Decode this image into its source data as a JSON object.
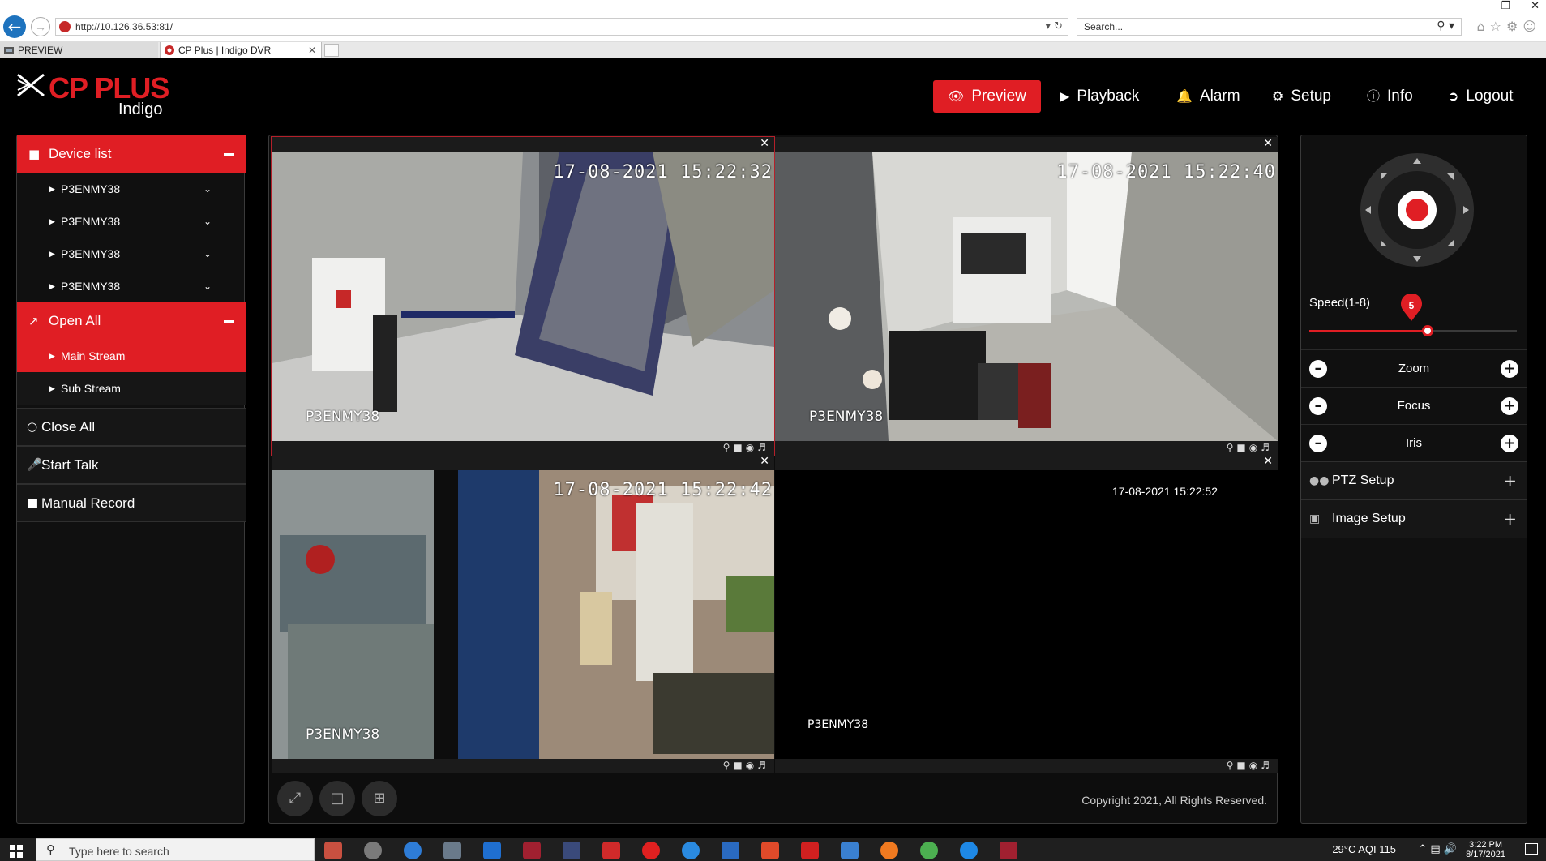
{
  "browser": {
    "url": "http://10.126.36.53:81/",
    "search_placeholder": "Search...",
    "tabs": [
      {
        "label": "PREVIEW"
      },
      {
        "label": "CP Plus | Indigo DVR"
      }
    ]
  },
  "app": {
    "brand": "CP PLUS",
    "subbrand": "Indigo",
    "accent_color": "#e01e24",
    "nav": [
      {
        "label": "Preview",
        "icon": "eye-icon",
        "active": true
      },
      {
        "label": "Playback",
        "icon": "play-circle-icon"
      },
      {
        "label": "Alarm",
        "icon": "bell-icon"
      },
      {
        "label": "Setup",
        "icon": "gear-icon"
      },
      {
        "label": "Info",
        "icon": "info-icon"
      },
      {
        "label": "Logout",
        "icon": "logout-icon"
      }
    ]
  },
  "sidebar": {
    "device_list_label": "Device list",
    "devices": [
      {
        "label": "P3ENMY38"
      },
      {
        "label": "P3ENMY38"
      },
      {
        "label": "P3ENMY38"
      },
      {
        "label": "P3ENMY38"
      }
    ],
    "open_all_label": "Open All",
    "streams": [
      {
        "label": "Main Stream",
        "selected": true
      },
      {
        "label": "Sub Stream",
        "selected": false
      }
    ],
    "close_all_label": "Close All",
    "start_talk_label": "Start Talk",
    "manual_record_label": "Manual Record"
  },
  "cameras": [
    {
      "timestamp": "17-08-2021 15:22:32",
      "name": "P3ENMY38"
    },
    {
      "timestamp": "17-08-2021 15:22:40",
      "name": "P3ENMY38"
    },
    {
      "timestamp": "17-08-2021 15:22:42",
      "name": "P3ENMY38"
    },
    {
      "timestamp": "17-08-2021 15:22:52",
      "name": "P3ENMY38"
    }
  ],
  "footer": {
    "copyright": "Copyright 2021, All Rights Reserved."
  },
  "ptz": {
    "speed_label": "Speed(1-8)",
    "speed_value": "5",
    "speed_fraction": 0.57,
    "zoom_label": "Zoom",
    "focus_label": "Focus",
    "iris_label": "Iris",
    "ptz_setup_label": "PTZ Setup",
    "image_setup_label": "Image Setup"
  },
  "taskbar": {
    "search_placeholder": "Type here to search",
    "weather": "29°C",
    "aqi": "AQI 115",
    "time": "3:22 PM",
    "date": "8/17/2021"
  }
}
